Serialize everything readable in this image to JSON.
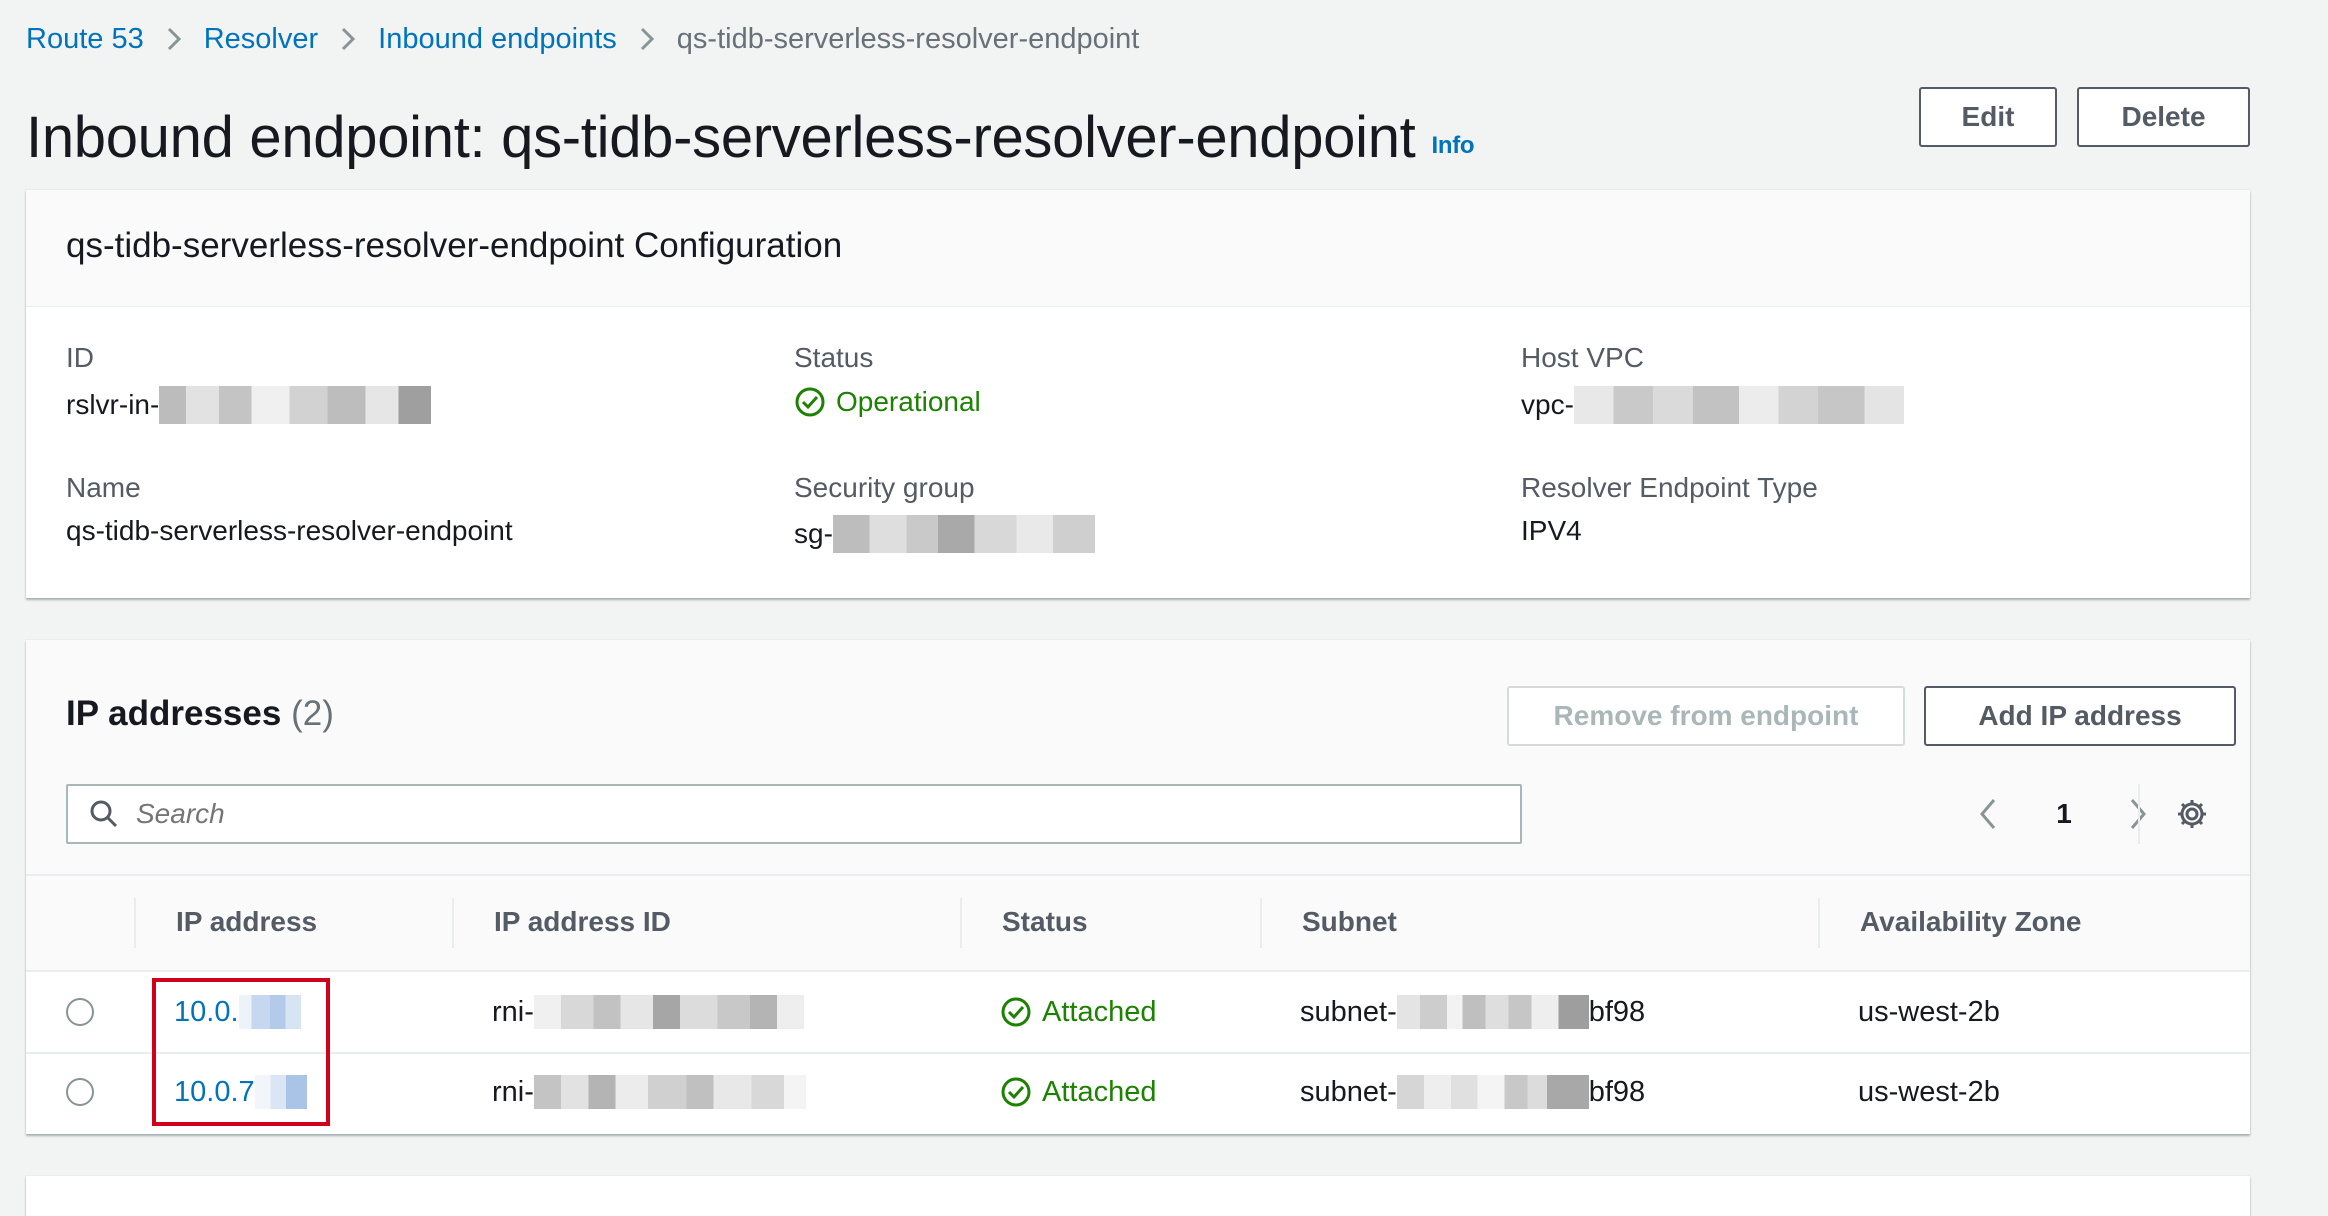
{
  "breadcrumb": {
    "items": [
      "Route 53",
      "Resolver",
      "Inbound endpoints"
    ],
    "current": "qs-tidb-serverless-resolver-endpoint"
  },
  "header": {
    "title": "Inbound endpoint: qs-tidb-serverless-resolver-endpoint",
    "info": "Info",
    "edit_label": "Edit",
    "delete_label": "Delete"
  },
  "config": {
    "title": "qs-tidb-serverless-resolver-endpoint Configuration",
    "id_label": "ID",
    "id_prefix": "rslvr-in-",
    "status_label": "Status",
    "status_value": "Operational",
    "host_vpc_label": "Host VPC",
    "host_vpc_prefix": "vpc-",
    "name_label": "Name",
    "name_value": "qs-tidb-serverless-resolver-endpoint",
    "sg_label": "Security group",
    "sg_prefix": "sg-",
    "type_label": "Resolver Endpoint Type",
    "type_value": "IPV4"
  },
  "ip_section": {
    "title": "IP addresses",
    "count": "(2)",
    "remove_label": "Remove from endpoint",
    "add_label": "Add IP address",
    "search_placeholder": "Search",
    "page": "1",
    "columns": [
      "IP address",
      "IP address ID",
      "Status",
      "Subnet",
      "Availability Zone"
    ],
    "rows": [
      {
        "ip": "10.0.",
        "ip_id_prefix": "rni-",
        "status": "Attached",
        "subnet_prefix": "subnet-",
        "subnet_suffix": "bf98",
        "az": "us-west-2b"
      },
      {
        "ip": "10.0.7",
        "ip_id_prefix": "rni-",
        "status": "Attached",
        "subnet_prefix": "subnet-",
        "subnet_suffix": "bf98",
        "az": "us-west-2b"
      }
    ]
  },
  "colors": {
    "link": "#0073bb",
    "success": "#1d8102",
    "highlight_box": "#d0021b"
  },
  "icons": [
    "chevron-right-icon",
    "status-success-icon",
    "search-icon",
    "chevron-left-icon",
    "gear-icon"
  ]
}
